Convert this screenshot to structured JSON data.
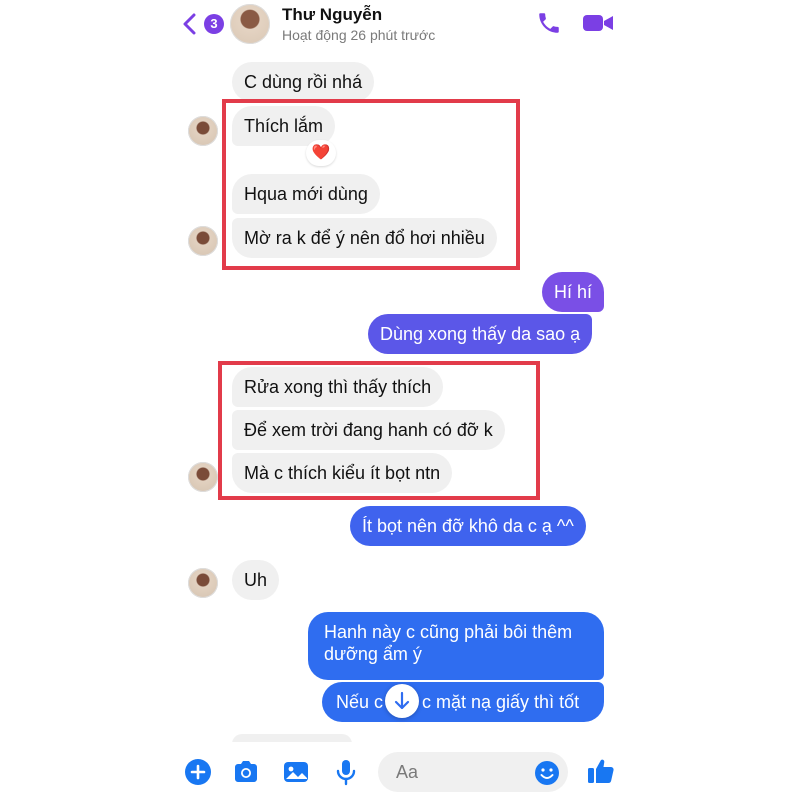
{
  "colors": {
    "accent": "#7b3fe4",
    "outgoing_purple": "#5b57e8",
    "outgoing_blue": "#2f6df0",
    "incoming_bg": "#f0f0f0",
    "highlight_red": "#e23b4a",
    "composer_blue": "#1877f2"
  },
  "header": {
    "unread_count": "3",
    "contact_name": "Thư Nguyễn",
    "status": "Hoạt động 26 phút trước",
    "icons": [
      "back-chevron-icon",
      "phone-icon",
      "video-camera-icon"
    ]
  },
  "messages": [
    {
      "from": "them",
      "text": "C dùng rồi nhá"
    },
    {
      "from": "them",
      "text": "Thích lắm",
      "reaction": "❤️"
    },
    {
      "from": "them",
      "text": "Hqua mới dùng"
    },
    {
      "from": "them",
      "text": "Mờ ra k để ý nên đổ hơi nhiều"
    },
    {
      "from": "me",
      "text": "Hí hí"
    },
    {
      "from": "me",
      "text": "Dùng xong thấy da sao ạ"
    },
    {
      "from": "them",
      "text": "Rửa xong thì thấy thích"
    },
    {
      "from": "them",
      "text": "Để xem trời đang hanh có đỡ k"
    },
    {
      "from": "them",
      "text": "Mà c thích kiểu ít bọt ntn"
    },
    {
      "from": "me",
      "text": "Ít bọt nên đỡ khô da c ạ ^^"
    },
    {
      "from": "them",
      "text": "Uh"
    },
    {
      "from": "me",
      "text": "Hanh này c cũng phải bôi thêm"
    },
    {
      "from": "me",
      "text": "dưỡng ẩm ý"
    },
    {
      "from": "me",
      "text": "Nếu c",
      "partial": true
    },
    {
      "from": "me",
      "text": "c mặt nạ giấy thì tốt",
      "partial": true
    }
  ],
  "composer": {
    "placeholder": "Aa",
    "icons": [
      "plus-icon",
      "camera-icon",
      "image-icon",
      "microphone-icon",
      "emoji-icon",
      "thumbs-up-icon"
    ]
  }
}
